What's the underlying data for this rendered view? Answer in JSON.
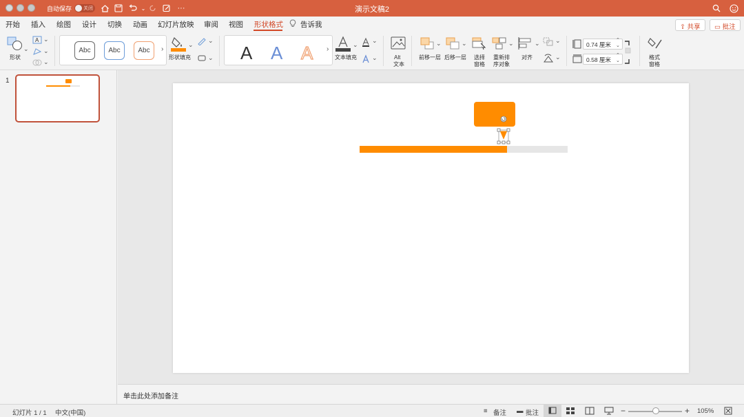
{
  "titlebar": {
    "autosave_label": "自动保存",
    "autosave_state": "关闭",
    "doc_title": "演示文稿2"
  },
  "tabs": [
    {
      "label": "开始"
    },
    {
      "label": "插入"
    },
    {
      "label": "绘图"
    },
    {
      "label": "设计"
    },
    {
      "label": "切换"
    },
    {
      "label": "动画"
    },
    {
      "label": "幻灯片放映"
    },
    {
      "label": "审阅"
    },
    {
      "label": "视图"
    },
    {
      "label": "形状格式"
    },
    {
      "label": "告诉我"
    }
  ],
  "active_tab": "形状格式",
  "share": {
    "share_label": "共享",
    "comment_label": "批注"
  },
  "ribbon": {
    "shape_label": "形状",
    "style_samples": [
      "Abc",
      "Abc",
      "Abc"
    ],
    "shape_fill_label": "形状填充",
    "text_samples": [
      "A",
      "A",
      "A"
    ],
    "text_fill_label": "文本填充",
    "alt_text_label_1": "Alt",
    "alt_text_label_2": "文本",
    "bring_forward_label": "前移一层",
    "send_backward_label": "后移一层",
    "selection_pane_label_1": "选择",
    "selection_pane_label_2": "窗格",
    "reorder_label_1": "重新排",
    "reorder_label_2": "序对象",
    "align_label": "对齐",
    "height_value": "0.74 厘米",
    "width_value": "0.58 厘米",
    "format_pane_label_1": "格式",
    "format_pane_label_2": "窗格"
  },
  "slides": {
    "thumb_number": "1"
  },
  "notes": {
    "placeholder": "单击此处添加备注"
  },
  "statusbar": {
    "slide_count": "幻灯片 1 / 1",
    "language": "中文(中国)",
    "notes_label": "备注",
    "comments_label": "批注",
    "zoom": "105%"
  },
  "colors": {
    "accent": "#d24726",
    "titlebar": "#d7603f",
    "shape_orange": "#ff8c00",
    "progress_track": "#e6e6e6"
  },
  "slide_content": {
    "progress_fraction": 0.71
  }
}
